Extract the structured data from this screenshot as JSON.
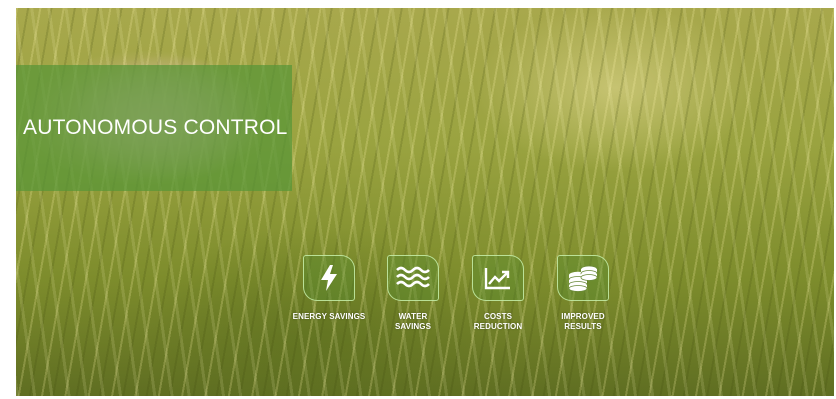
{
  "hero": {
    "title": "AUTONOMOUS CONTROL",
    "features": [
      {
        "icon": "lightning-bolt-icon",
        "label": "ENERGY SAVINGS"
      },
      {
        "icon": "water-waves-icon",
        "label": "WATER SAVINGS"
      },
      {
        "icon": "chart-trend-icon",
        "label": "COSTS REDUCTION"
      },
      {
        "icon": "coins-stack-icon",
        "label": "IMPROVED RESULTS"
      }
    ]
  }
}
